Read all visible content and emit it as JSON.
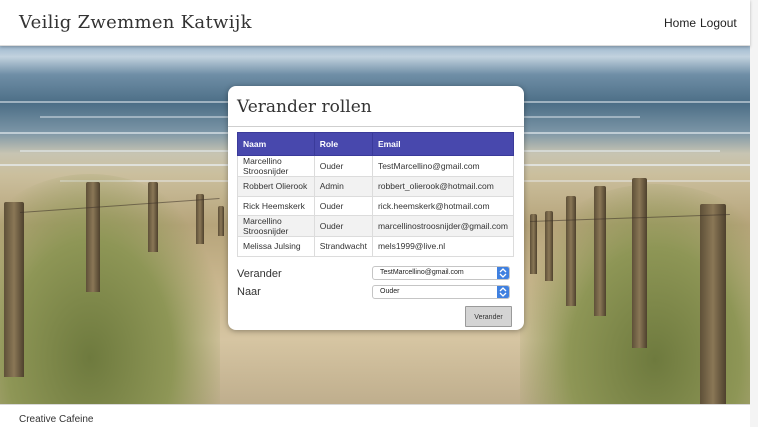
{
  "navbar": {
    "brand": "Veilig Zwemmen Katwijk",
    "links": [
      "Home",
      "Logout"
    ]
  },
  "card": {
    "title": "Verander rollen",
    "table": {
      "headers": [
        "Naam",
        "Role",
        "Email"
      ],
      "rows": [
        [
          "Marcellino Stroosnijder",
          "Ouder",
          "TestMarcellino@gmail.com"
        ],
        [
          "Robbert Olierook",
          "Admin",
          "robbert_olierook@hotmail.com"
        ],
        [
          "Rick Heemskerk",
          "Ouder",
          "rick.heemskerk@hotmail.com"
        ],
        [
          "Marcellino Stroosnijder",
          "Ouder",
          "marcellinostroosnijder@gmail.com"
        ],
        [
          "Melissa Julsing",
          "Strandwacht",
          "mels1999@live.nl"
        ]
      ]
    },
    "form": {
      "verander_label": "Verander",
      "verander_value": "TestMarcellino@gmail.com",
      "naar_label": "Naar",
      "naar_value": "Ouder",
      "submit_label": "Verander"
    }
  },
  "footer": {
    "text": "Creative Cafeine"
  },
  "colors": {
    "table_header": "#4848ad",
    "select_arrow": "#3f80e0"
  }
}
